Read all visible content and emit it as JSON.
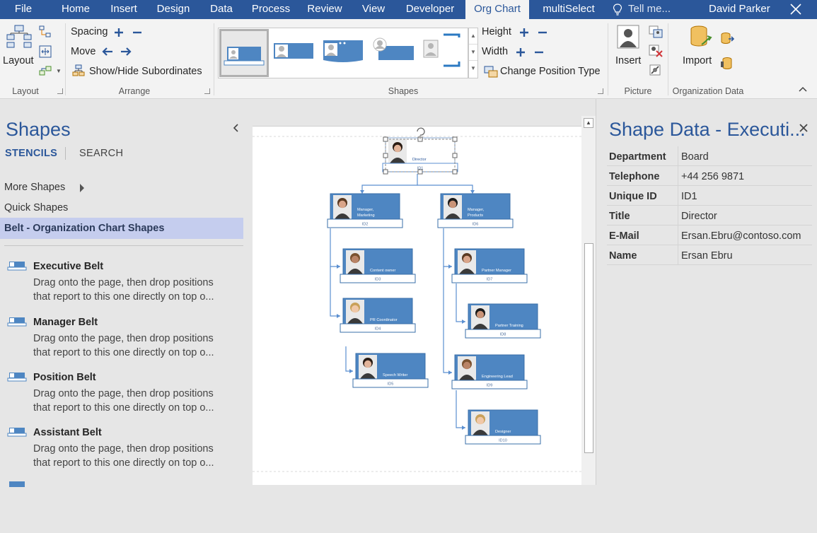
{
  "menu": {
    "tabs": [
      {
        "label": "File"
      },
      {
        "label": "Home"
      },
      {
        "label": "Insert"
      },
      {
        "label": "Design"
      },
      {
        "label": "Data"
      },
      {
        "label": "Process"
      },
      {
        "label": "Review"
      },
      {
        "label": "View"
      },
      {
        "label": "Developer"
      },
      {
        "label": "Org Chart"
      },
      {
        "label": "multiSelect"
      },
      {
        "label": "Tell me..."
      }
    ],
    "active_tab": "Org Chart",
    "user": "David Parker"
  },
  "ribbon": {
    "layout": {
      "label": "Layout",
      "group_label": "Layout"
    },
    "arrange": {
      "spacing": "Spacing",
      "move": "Move",
      "show_hide": "Show/Hide Subordinates",
      "group_label": "Arrange"
    },
    "shapes": {
      "height": "Height",
      "width": "Width",
      "change_position_type": "Change Position Type",
      "group_label": "Shapes"
    },
    "picture": {
      "insert": "Insert",
      "group_label": "Picture"
    },
    "org_data": {
      "import": "Import",
      "group_label": "Organization Data"
    }
  },
  "shapes_panel": {
    "title": "Shapes",
    "tabs": [
      "STENCILS",
      "SEARCH"
    ],
    "nav": [
      "More Shapes",
      "Quick Shapes",
      "Belt - Organization Chart Shapes"
    ],
    "stencils": [
      {
        "name": "Executive Belt",
        "desc1": "Drag onto the page, then drop positions",
        "desc2": "that report to this one directly on top o..."
      },
      {
        "name": "Manager Belt",
        "desc1": "Drag onto the page, then drop positions",
        "desc2": "that report to this one directly on top o..."
      },
      {
        "name": "Position Belt",
        "desc1": "Drag onto the page, then drop positions",
        "desc2": "that report to this one directly on top o..."
      },
      {
        "name": "Assistant Belt",
        "desc1": "Drag onto the page, then drop positions",
        "desc2": "that report to this one directly on top o..."
      }
    ]
  },
  "org_chart": {
    "nodes": [
      {
        "title": "Director",
        "id": "ID1",
        "selected": true
      },
      {
        "title": "Manager, Marketing",
        "id": "ID2"
      },
      {
        "title": "Manager, Products",
        "id": "ID6"
      },
      {
        "title": "Content owner",
        "id": "ID3"
      },
      {
        "title": "PR Coordinator",
        "id": "ID4"
      },
      {
        "title": "Speech Writer",
        "id": "ID5"
      },
      {
        "title": "Partner Manager",
        "id": "ID7"
      },
      {
        "title": "Partner Training",
        "id": "ID8"
      },
      {
        "title": "Engineering Lead",
        "id": "ID9"
      },
      {
        "title": "Designer",
        "id": "ID10"
      }
    ]
  },
  "shape_data": {
    "title": "Shape Data - Executi...",
    "rows": [
      {
        "key": "Department",
        "value": "Board"
      },
      {
        "key": "Telephone",
        "value": "+44 256 9871"
      },
      {
        "key": "Unique ID",
        "value": "ID1"
      },
      {
        "key": "Title",
        "value": "Director"
      },
      {
        "key": "E-Mail",
        "value": "Ersan.Ebru@contoso.com"
      },
      {
        "key": "Name",
        "value": "Ersan Ebru"
      }
    ]
  },
  "colors": {
    "accent": "#2b579a",
    "node_fill": "#4e86c2",
    "node_dark": "#3a6fa8",
    "belt_fill": "#ffffff",
    "selected_nav": "#c5cdee"
  },
  "icons": [
    "layout-icon",
    "spacing-plus-icon",
    "spacing-minus-icon",
    "move-left-icon",
    "move-right-icon",
    "show-hide-icon",
    "height-plus-icon",
    "height-minus-icon",
    "width-plus-icon",
    "width-minus-icon",
    "change-position-icon",
    "insert-picture-icon",
    "import-icon",
    "lightbulb-icon",
    "close-icon",
    "rotate-handle-icon"
  ]
}
